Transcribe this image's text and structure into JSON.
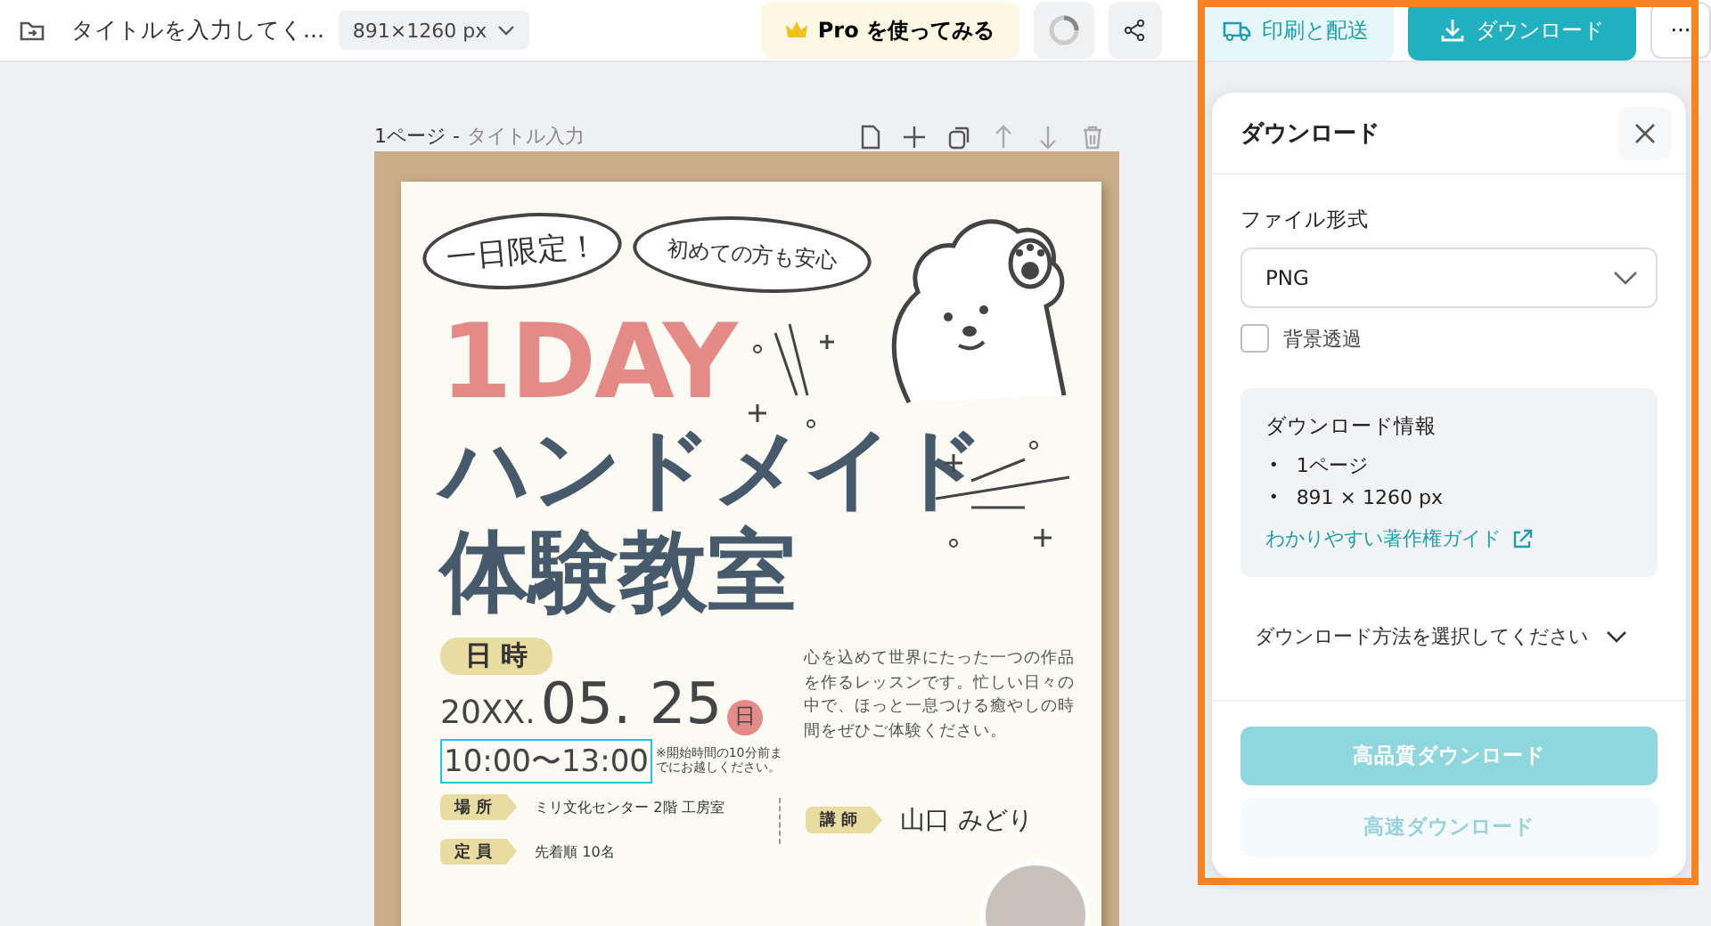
{
  "topbar": {
    "title": "タイトルを入力してく...",
    "size": "891×1260 px",
    "pro_button": "Pro を使ってみる",
    "print_button": "印刷と配送",
    "download_button": "ダウンロード",
    "more_button": "···"
  },
  "page_header": {
    "page_number": "1ページ",
    "separator": "-",
    "page_title": "タイトル入力"
  },
  "poster": {
    "bubbles": [
      "一日限定！",
      "初めての方も安心"
    ],
    "headline": "1DAY",
    "title_lines": [
      "ハンドメイド",
      "体験教室"
    ],
    "date_tag": "日 時",
    "year": "20XX.",
    "date": "05. 25",
    "weekday": "日",
    "time": {
      "text": "10:00〜13:00",
      "selected": true
    },
    "time_note": "※開始時間の10分前までにお越しください。",
    "description": "心を込めて世界にたった一つの作品を作るレッスンです。忙しい日々の中で、ほっと一息つける癒やしの時間をぜひご体験ください。",
    "info_rows": [
      {
        "label": "場 所",
        "value": "ミリ文化センター 2階 工房室"
      },
      {
        "label": "定 員",
        "value": "先着順 10名"
      }
    ],
    "instructor": {
      "label": "講 師",
      "name": "山口 みどり"
    }
  },
  "panel": {
    "title": "ダウンロード",
    "format_label": "ファイル形式",
    "format": "PNG",
    "transparent": {
      "label": "背景透過",
      "checked": false
    },
    "info": {
      "title": "ダウンロード情報",
      "bullet": "•",
      "items": [
        "1ページ",
        "891 × 1260 px"
      ],
      "link": "わかりやすい著作権ガイド"
    },
    "method": "ダウンロード方法を選択してください",
    "buttons": [
      {
        "label": "高品質ダウンロード",
        "kind": "primary",
        "disabled": true
      },
      {
        "label": "高速ダウンロード",
        "kind": "secondary",
        "disabled": true
      }
    ]
  }
}
